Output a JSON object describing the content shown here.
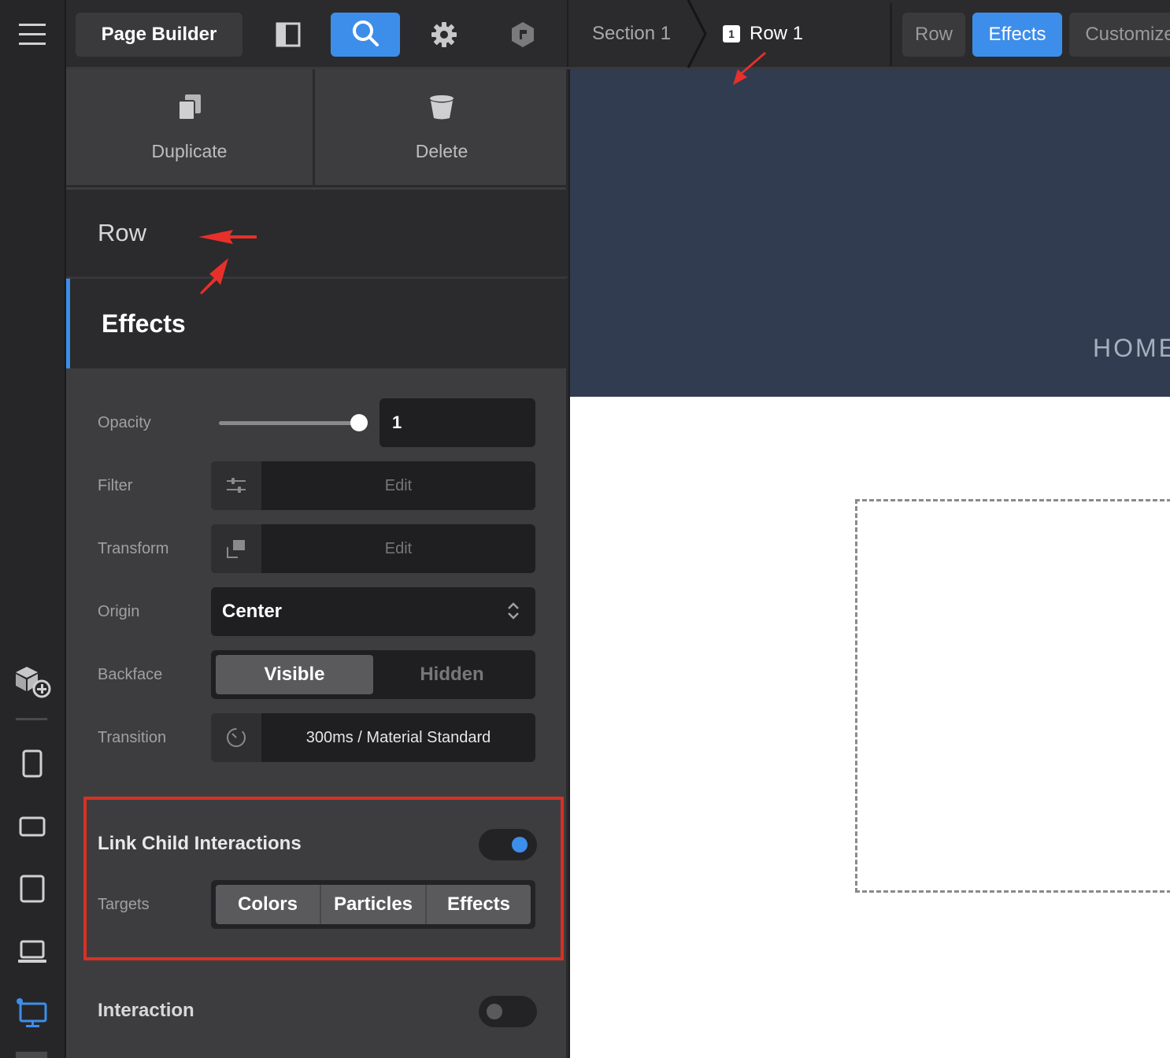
{
  "toolbar": {
    "page_builder_label": "Page Builder"
  },
  "breadcrumb": {
    "section": "Section 1",
    "row_badge": "1",
    "row": "Row 1"
  },
  "tabs": [
    {
      "label": "Row",
      "active": false
    },
    {
      "label": "Effects",
      "active": true
    },
    {
      "label": "Customize",
      "active": false
    }
  ],
  "actions": {
    "duplicate": "Duplicate",
    "delete": "Delete"
  },
  "panel_nav": {
    "row": "Row",
    "effects": "Effects"
  },
  "controls": {
    "opacity": {
      "label": "Opacity",
      "value": "1",
      "slider_fraction": 1.0
    },
    "filter": {
      "label": "Filter",
      "button": "Edit"
    },
    "transform": {
      "label": "Transform",
      "button": "Edit"
    },
    "origin": {
      "label": "Origin",
      "value": "Center"
    },
    "backface": {
      "label": "Backface",
      "options": [
        "Visible",
        "Hidden"
      ],
      "selected": "Visible"
    },
    "transition": {
      "label": "Transition",
      "value": "300ms / Material Standard"
    }
  },
  "link_child": {
    "title": "Link Child Interactions",
    "enabled": true,
    "targets_label": "Targets",
    "targets": [
      "Colors",
      "Particles",
      "Effects"
    ]
  },
  "interaction": {
    "label": "Interaction",
    "enabled": false
  },
  "canvas": {
    "hero_text": "HOME"
  },
  "colors": {
    "accent": "#3d8eea",
    "highlight": "#d93025",
    "hero_bg": "#313c50"
  }
}
